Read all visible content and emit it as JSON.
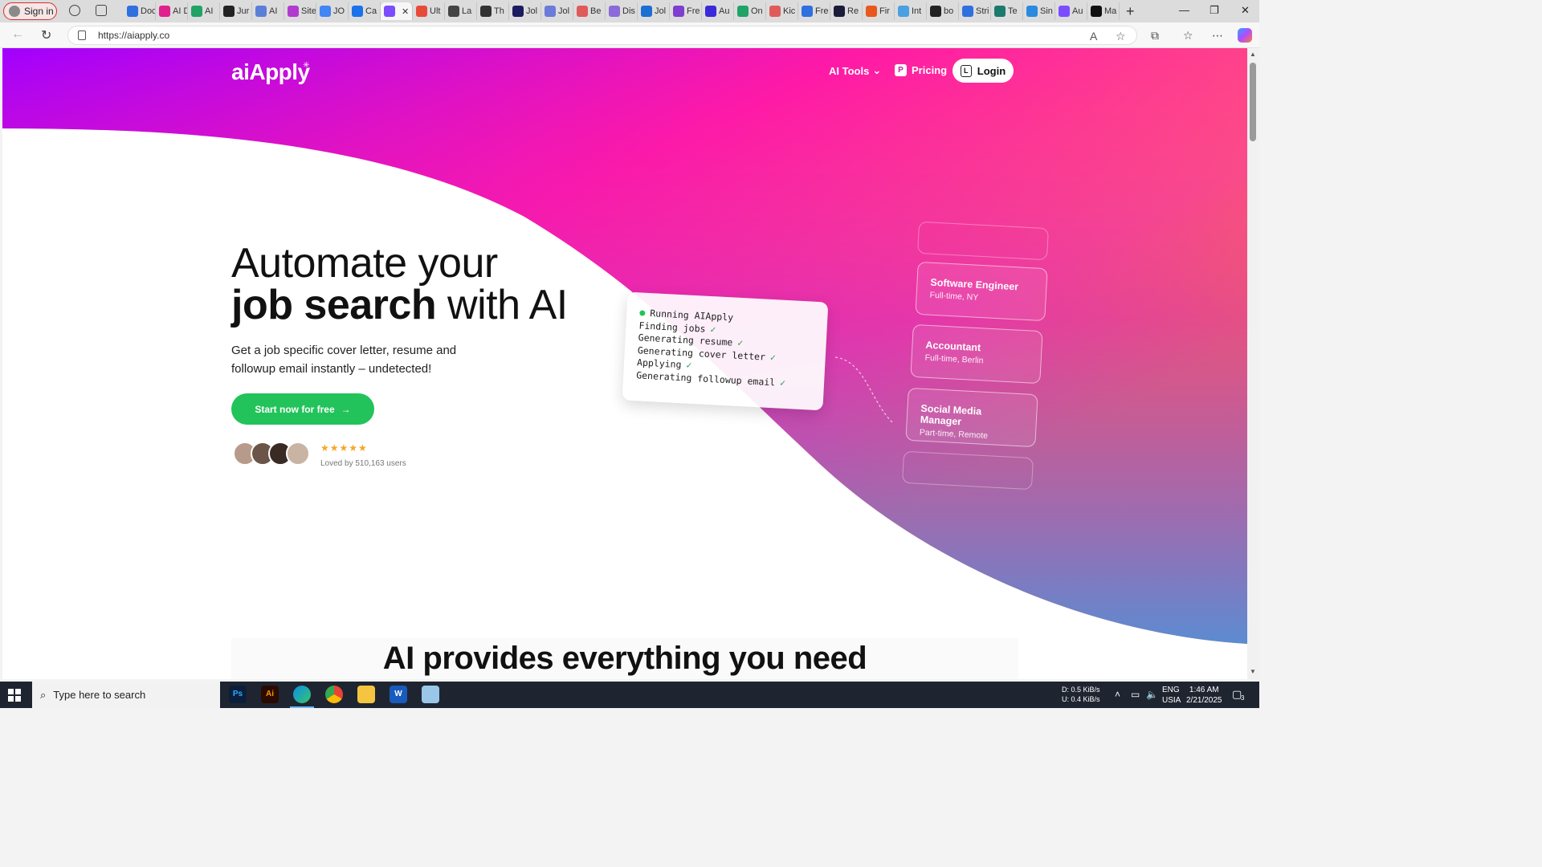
{
  "browser": {
    "signin_label": "Sign in",
    "tabs": [
      {
        "label": "Doc",
        "color": "#2f6fdf"
      },
      {
        "label": "AI D",
        "color": "#e0208c"
      },
      {
        "label": "AI",
        "color": "#21a366"
      },
      {
        "label": "Jur",
        "color": "#222222"
      },
      {
        "label": "AI",
        "color": "#5b7fd9"
      },
      {
        "label": "Site",
        "color": "#b13bcf"
      },
      {
        "label": "JO",
        "color": "#4285f4"
      },
      {
        "label": "Ca",
        "color": "#1a73e8"
      },
      {
        "label": "",
        "color": "#7b4dff",
        "active": true
      },
      {
        "label": "Ult",
        "color": "#e84a3a"
      },
      {
        "label": "La",
        "color": "#444444"
      },
      {
        "label": "Th",
        "color": "#333333"
      },
      {
        "label": "Jol",
        "color": "#1b1b5e"
      },
      {
        "label": "Jol",
        "color": "#6b7bd9"
      },
      {
        "label": "Be",
        "color": "#e05a5a"
      },
      {
        "label": "Dis",
        "color": "#8a6bd9"
      },
      {
        "label": "Jol",
        "color": "#1d6fd1"
      },
      {
        "label": "Fre",
        "color": "#7e3ecf"
      },
      {
        "label": "Au",
        "color": "#3a2ad9"
      },
      {
        "label": "On",
        "color": "#21a366"
      },
      {
        "label": "Kic",
        "color": "#e05a5a"
      },
      {
        "label": "Fre",
        "color": "#2f6fdf"
      },
      {
        "label": "Re",
        "color": "#1b1b3a"
      },
      {
        "label": "Fir",
        "color": "#e8581c"
      },
      {
        "label": "Int",
        "color": "#4aa0e0"
      },
      {
        "label": "bo",
        "color": "#222222"
      },
      {
        "label": "Stri",
        "color": "#2f6fdf"
      },
      {
        "label": "Te",
        "color": "#1b7a6e"
      },
      {
        "label": "Sin",
        "color": "#2a8ae0"
      },
      {
        "label": "Au",
        "color": "#7b4dff"
      },
      {
        "label": "Ma",
        "color": "#111111"
      }
    ],
    "url": "https://aiapply.co"
  },
  "site": {
    "logo": "aiApply",
    "nav": {
      "ai_tools": "AI Tools",
      "pricing_badge": "P",
      "pricing": "Pricing",
      "login_badge": "L",
      "login": "Login"
    },
    "hero": {
      "title_line1": "Automate your",
      "title_bold": "job search",
      "title_rest": " with AI",
      "subtitle": "Get a job specific cover letter, resume and followup email instantly – undetected!",
      "cta": "Start now for free",
      "cta_arrow": "→",
      "stars": "★★★★★",
      "loved": "Loved by 510,163 users"
    },
    "terminal": {
      "lines": [
        {
          "text": "Running AIApply",
          "dot": true,
          "check": false
        },
        {
          "text": "Finding jobs",
          "dot": false,
          "check": true
        },
        {
          "text": "Generating resume",
          "dot": false,
          "check": true
        },
        {
          "text": "Generating cover letter",
          "dot": false,
          "check": true
        },
        {
          "text": "Applying",
          "dot": false,
          "check": true
        },
        {
          "text": "Generating followup email",
          "dot": false,
          "check": true
        }
      ],
      "check_mark": "✓"
    },
    "jobs": [
      {
        "title": "Software Engineer",
        "sub": "Full-time, NY"
      },
      {
        "title": "Accountant",
        "sub": "Full-time, Berlin"
      },
      {
        "title": "Social Media Manager",
        "sub": "Part-time, Remote"
      }
    ],
    "section_title": "AI provides everything you need",
    "colors": {
      "gradient_purple": "#a100ff",
      "gradient_pink": "#ff1aa6",
      "gradient_orange": "#ff9a1a",
      "gradient_blue": "#4a8ae6",
      "cta_green": "#22c35a"
    }
  },
  "taskbar": {
    "search_placeholder": "Type here to search",
    "apps": [
      "Ps",
      "Ai",
      "Edge",
      "Chrome",
      "Explorer",
      "W",
      "Notepad"
    ],
    "net_down": "D:    0.5 KiB/s",
    "net_up": "U:    0.4 KiB/s",
    "lang": "ENG",
    "region": "USIA",
    "time": "1:46 AM",
    "date": "2/21/2025",
    "notifications": "3"
  }
}
